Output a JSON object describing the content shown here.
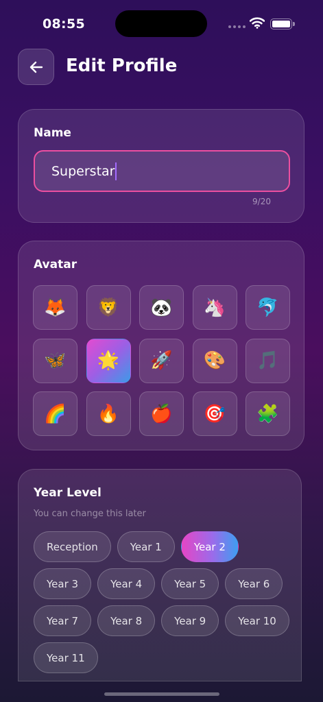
{
  "status_bar": {
    "time": "08:55"
  },
  "header": {
    "title": "Edit Profile",
    "back_icon": "arrow-left-icon"
  },
  "name_section": {
    "label": "Name",
    "value": "Superstar",
    "counter": "9/20",
    "accent_color": "#ec4fa0"
  },
  "avatar_section": {
    "label": "Avatar",
    "selected": "star",
    "items": [
      {
        "name": "fox",
        "glyph": "🦊"
      },
      {
        "name": "lion",
        "glyph": "🦁"
      },
      {
        "name": "panda",
        "glyph": "🐼"
      },
      {
        "name": "unicorn",
        "glyph": "🦄"
      },
      {
        "name": "dolphin",
        "glyph": "🐬"
      },
      {
        "name": "butterfly",
        "glyph": "🦋"
      },
      {
        "name": "star",
        "glyph": "🌟"
      },
      {
        "name": "rocket",
        "glyph": "🚀"
      },
      {
        "name": "palette",
        "glyph": "🎨"
      },
      {
        "name": "music-note",
        "glyph": "🎵"
      },
      {
        "name": "rainbow",
        "glyph": "🌈"
      },
      {
        "name": "fire",
        "glyph": "🔥"
      },
      {
        "name": "apple",
        "glyph": "🍎"
      },
      {
        "name": "target",
        "glyph": "🎯"
      },
      {
        "name": "puzzle",
        "glyph": "🧩"
      }
    ]
  },
  "year_section": {
    "label": "Year Level",
    "subtitle": "You can change this later",
    "selected": "Year 2",
    "options": [
      "Reception",
      "Year 1",
      "Year 2",
      "Year 3",
      "Year 4",
      "Year 5",
      "Year 6",
      "Year 7",
      "Year 8",
      "Year 9",
      "Year 10",
      "Year 11"
    ]
  }
}
